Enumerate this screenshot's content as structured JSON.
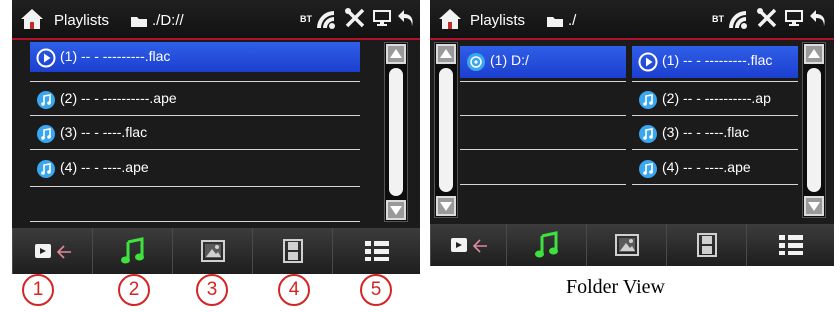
{
  "left_screen": {
    "header": {
      "title": "Playlists",
      "path": "./D://",
      "bt_label": "BT"
    },
    "files": [
      {
        "label": "(1) -- - ---------.flac",
        "icon": "play-circle-icon",
        "selected": true
      },
      {
        "label": "(2) -- - ----------.ape",
        "icon": "music-note-icon",
        "selected": false
      },
      {
        "label": "(3) -- - ----.flac",
        "icon": "music-note-icon",
        "selected": false
      },
      {
        "label": "(4) -- - ----.ape",
        "icon": "music-note-icon",
        "selected": false
      }
    ],
    "toolbar": [
      {
        "icon": "back-switch-icon"
      },
      {
        "icon": "music-note-icon",
        "active": true
      },
      {
        "icon": "picture-icon"
      },
      {
        "icon": "film-icon"
      },
      {
        "icon": "list-menu-icon"
      }
    ]
  },
  "right_screen": {
    "header": {
      "title": "Playlists",
      "path": "./",
      "bt_label": "BT"
    },
    "folders": [
      {
        "label": "(1) D:/",
        "icon": "disc-icon",
        "selected": true
      }
    ],
    "files": [
      {
        "label": "(1) -- - ---------.flac",
        "icon": "play-circle-icon",
        "selected": true
      },
      {
        "label": "(2) -- - ----------.ap",
        "icon": "music-note-icon",
        "selected": false
      },
      {
        "label": "(3) -- - ----.flac",
        "icon": "music-note-icon",
        "selected": false
      },
      {
        "label": "(4) -- - ----.ape",
        "icon": "music-note-icon",
        "selected": false
      }
    ]
  },
  "callouts": [
    "1",
    "2",
    "3",
    "4",
    "5"
  ],
  "caption": "Folder View",
  "colors": {
    "selection": "#2a55e0",
    "accent_green": "#3ee23e",
    "header_line": "#b1122a",
    "callout_red": "#d52424"
  }
}
